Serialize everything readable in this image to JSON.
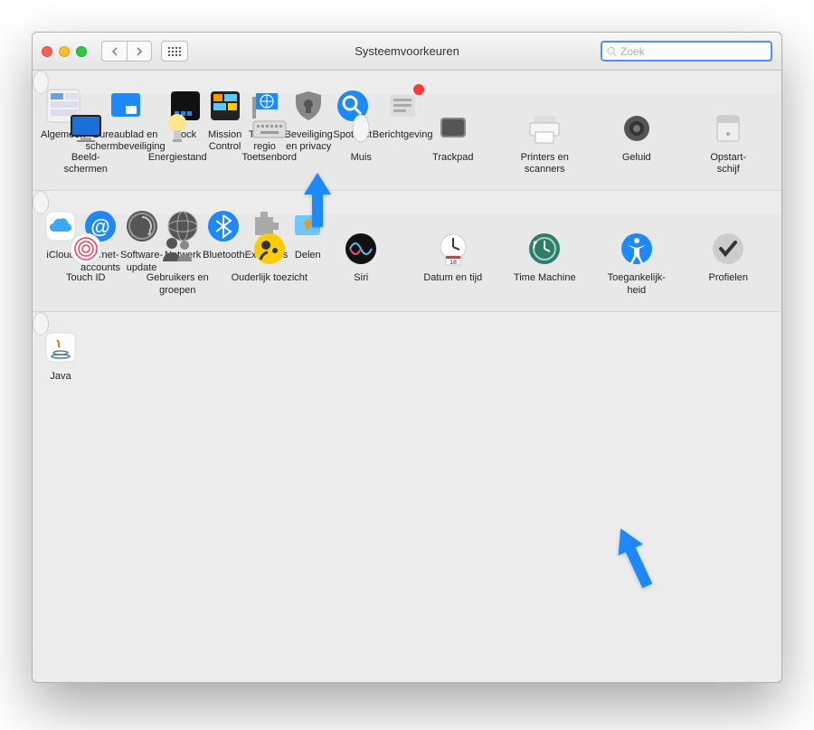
{
  "window_title": "Systeemvoorkeuren",
  "search_placeholder": "Zoek",
  "rows": [
    [
      {
        "name": "general",
        "label": "Algemeen"
      },
      {
        "name": "desktop",
        "label": "Bureaublad en schermbeveiliging"
      },
      {
        "name": "dock",
        "label": "Dock"
      },
      {
        "name": "mission-control",
        "label": "Mission Control"
      },
      {
        "name": "language",
        "label": "Taal en regio"
      },
      {
        "name": "security",
        "label": "Beveiliging en privacy"
      },
      {
        "name": "spotlight",
        "label": "Spotlight"
      },
      {
        "name": "notifications",
        "label": "Berichtgeving",
        "badge": true
      }
    ],
    [
      {
        "name": "displays",
        "label": "Beeld-\nschermen"
      },
      {
        "name": "energy",
        "label": "Energiestand"
      },
      {
        "name": "keyboard",
        "label": "Toetsenbord"
      },
      {
        "name": "mouse",
        "label": "Muis"
      },
      {
        "name": "trackpad",
        "label": "Trackpad"
      },
      {
        "name": "printers",
        "label": "Printers en scanners"
      },
      {
        "name": "sound",
        "label": "Geluid"
      },
      {
        "name": "startup",
        "label": "Opstart-\nschijf"
      }
    ],
    [
      {
        "name": "icloud",
        "label": "iCloud"
      },
      {
        "name": "internet-accounts",
        "label": "Internet-\naccounts"
      },
      {
        "name": "software-update",
        "label": "Software-update"
      },
      {
        "name": "network",
        "label": "Netwerk"
      },
      {
        "name": "bluetooth",
        "label": "Bluetooth"
      },
      {
        "name": "extensions",
        "label": "Extensies"
      },
      {
        "name": "sharing",
        "label": "Delen"
      }
    ],
    [
      {
        "name": "touchid",
        "label": "Touch ID"
      },
      {
        "name": "users",
        "label": "Gebruikers en groepen"
      },
      {
        "name": "parental",
        "label": "Ouderlijk toezicht"
      },
      {
        "name": "siri",
        "label": "Siri"
      },
      {
        "name": "date",
        "label": "Datum en tijd"
      },
      {
        "name": "timemachine",
        "label": "Time Machine"
      },
      {
        "name": "accessibility",
        "label": "Toegankelijk-\nheid"
      },
      {
        "name": "profiles",
        "label": "Profielen"
      }
    ],
    [
      {
        "name": "java",
        "label": "Java"
      }
    ]
  ]
}
